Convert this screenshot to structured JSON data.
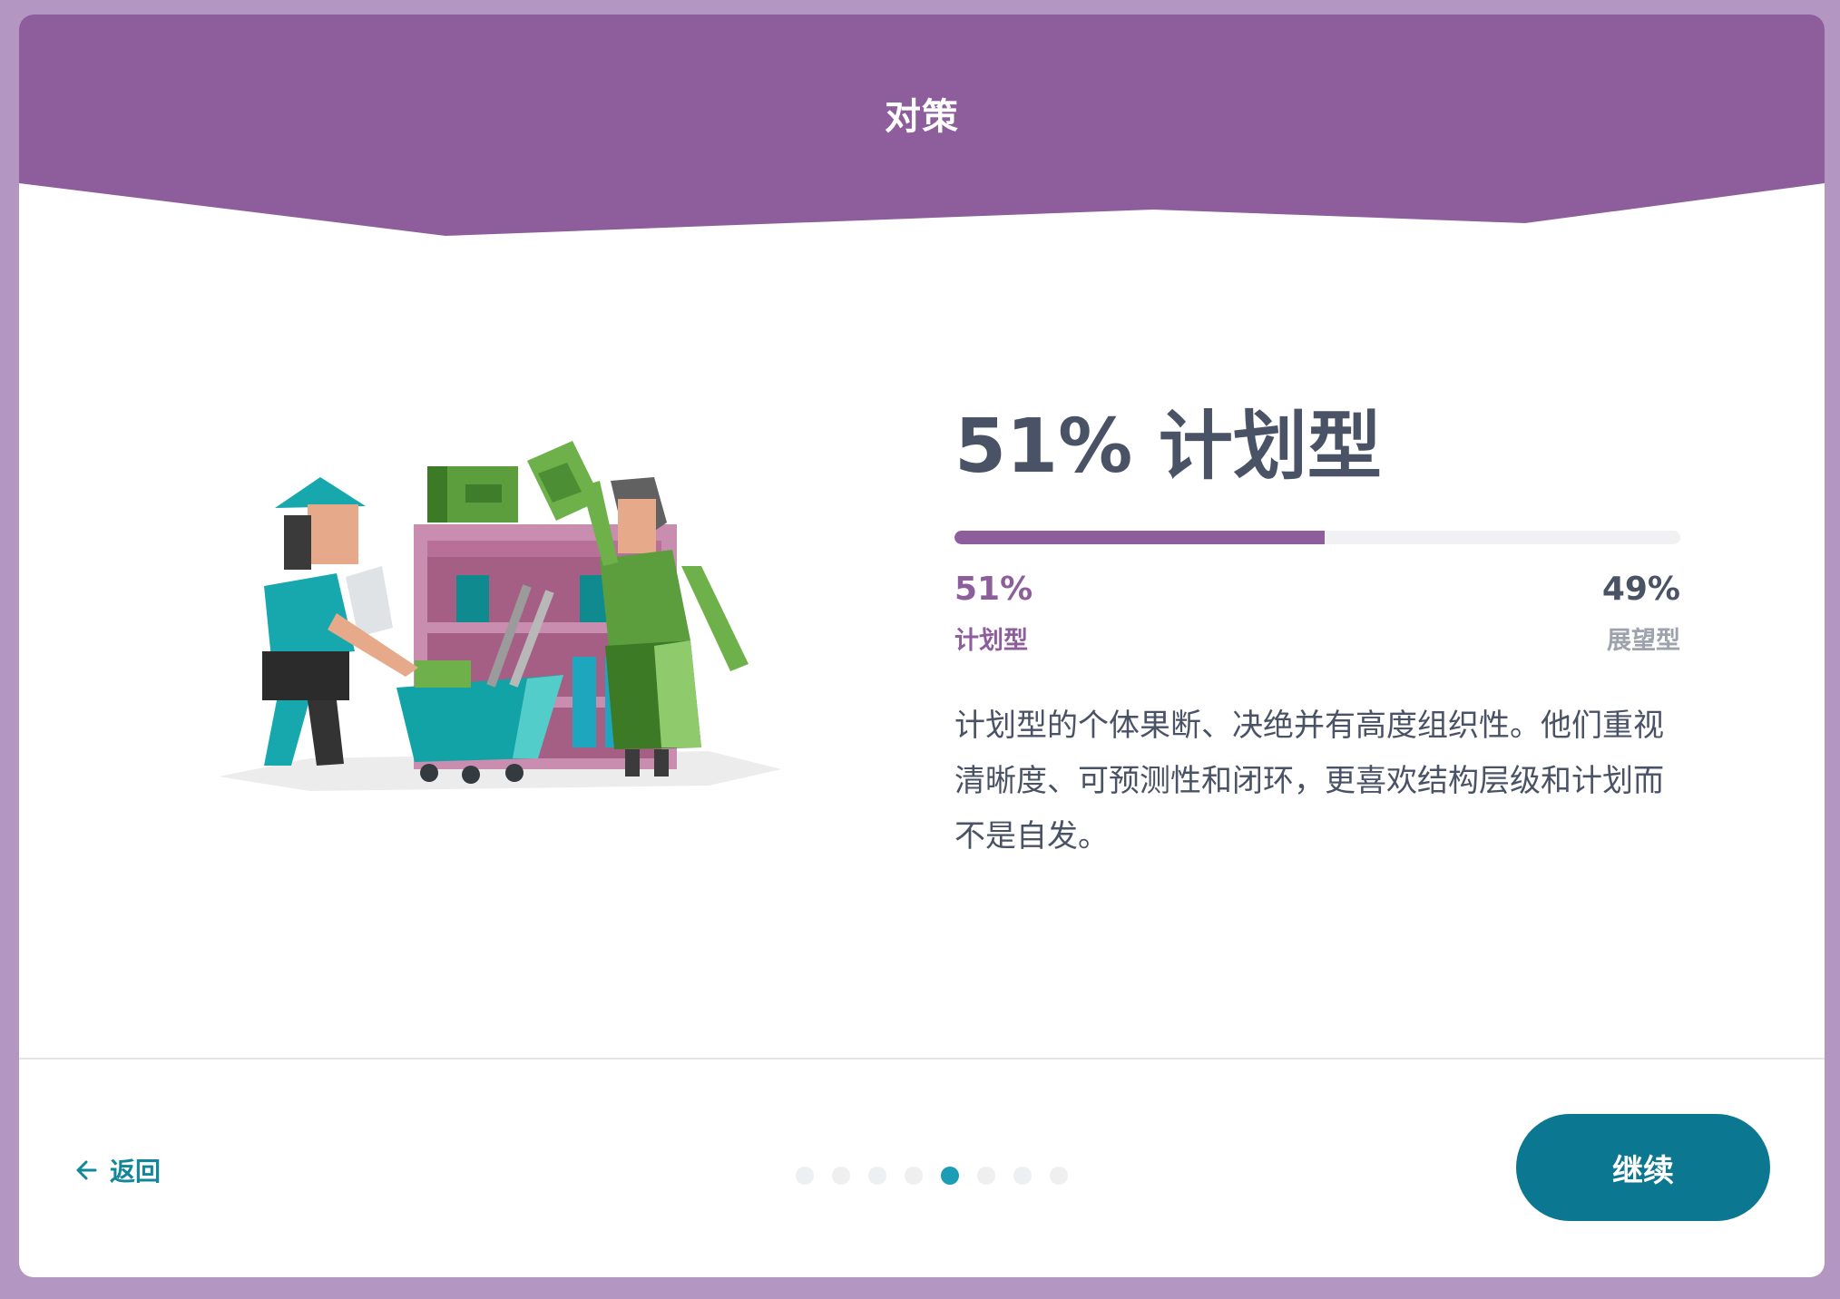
{
  "header": {
    "title": "对策",
    "color": "#8e5e9c"
  },
  "result": {
    "title": "51% 计划型",
    "progress_fraction": 0.51,
    "left": {
      "percent": "51%",
      "label": "计划型"
    },
    "right": {
      "percent": "49%",
      "label": "展望型"
    },
    "description": "计划型的个体果断、决绝并有高度组织性。他们重视清晰度、可预测性和闭环，更喜欢结构层级和计划而不是自发。"
  },
  "footer": {
    "back_label": "返回",
    "continue_label": "继续",
    "pagination": {
      "total": 8,
      "active_index": 4
    }
  },
  "colors": {
    "accent_purple": "#8e5e9c",
    "accent_teal": "#0c7791",
    "text_dark": "#4a5266",
    "text_muted": "#9ea2ad",
    "page_bg": "#b397c2"
  },
  "icons": {
    "back": "arrow-left-icon",
    "illustration": "shoppers-with-cart-illustration"
  }
}
